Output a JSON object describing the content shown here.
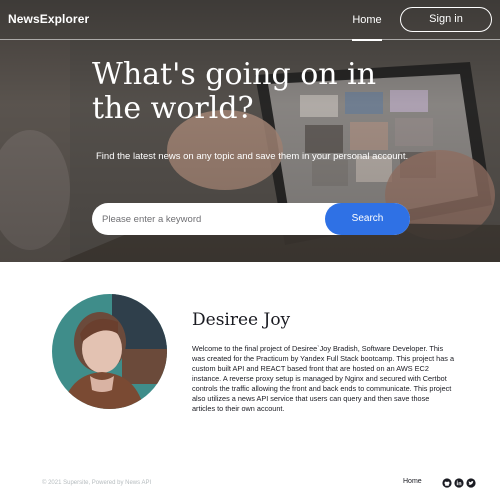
{
  "header": {
    "logo": "NewsExplorer",
    "nav_home": "Home",
    "signin": "Sign in"
  },
  "hero": {
    "title": "What's going on in the world?",
    "subtitle": "Find the latest news on any topic and save them in your personal account.",
    "search_placeholder": "Please enter a keyword",
    "search_button": "Search"
  },
  "about": {
    "name": "Desiree Joy",
    "bio": "Welcome to the final project of Desiree`Joy Bradish, Software Developer. This was created for the Practicum by Yandex Full Stack bootcamp. This project has a custom built API and REACT based front that are hosted on an AWS EC2 instance. A reverse proxy setup is managed by Nginx and secured with Certbot controls the traffic allowing the front and back ends to communicate. This project also utilizes a news API service that users can query and then save those articles to their own account."
  },
  "footer": {
    "copyright": "© 2021 Supersite, Powered by News API",
    "home": "Home",
    "social": [
      "github-icon",
      "linkedin-icon",
      "twitter-icon"
    ]
  },
  "colors": {
    "accent": "#2f71e5",
    "text": "#1a1b22",
    "muted": "#b6bcbf"
  }
}
